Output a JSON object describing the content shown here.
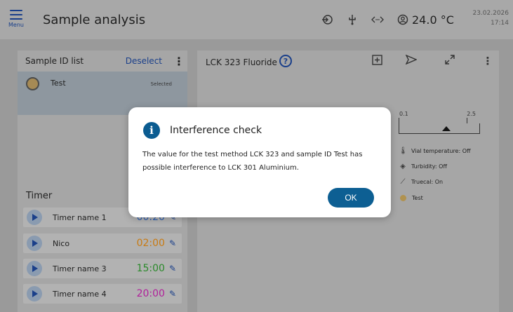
{
  "header": {
    "menu_label": "Menu",
    "title": "Sample analysis",
    "temperature": "24.0 °C",
    "date": "23.02.2026",
    "time": "17:14",
    "icons": [
      "login-icon",
      "usb-icon",
      "network-icon",
      "user-icon"
    ]
  },
  "sample_list": {
    "title": "Sample ID list",
    "deselect_label": "Deselect",
    "items": [
      {
        "name": "Test",
        "status": "Selected",
        "color": "#a68a55"
      }
    ]
  },
  "timer": {
    "title": "Timer",
    "items": [
      {
        "name": "Timer name 1",
        "time": "00:20",
        "color": "#2f5fb0"
      },
      {
        "name": "Nico",
        "time": "02:00",
        "color": "#c87a12"
      },
      {
        "name": "Timer name 3",
        "time": "15:00",
        "color": "#2a8a2a"
      },
      {
        "name": "Timer name 4",
        "time": "20:00",
        "color": "#b0209a"
      }
    ]
  },
  "main": {
    "title": "LCK 323 Fluoride",
    "scale": {
      "min": "0.1",
      "max": "2.5"
    },
    "info": {
      "vial_temperature": "Vial temperature: Off",
      "turbidity": "Turbidity: Off",
      "truecal": "Truecal: On",
      "sample": "Test"
    }
  },
  "dialog": {
    "title": "Interference check",
    "body": "The value for the test method LCK 323 and sample ID Test has possible interference to LCK 301 Aluminium.",
    "ok_label": "OK"
  },
  "colors": {
    "accent": "#0d5f93",
    "link": "#1a3f8a"
  }
}
